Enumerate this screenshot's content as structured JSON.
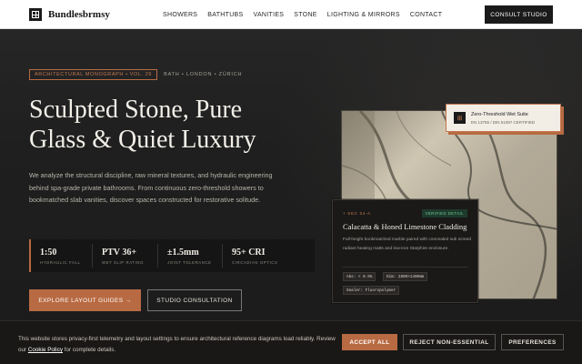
{
  "nav": {
    "brand": "Bundlesbrmsy",
    "links": [
      "SHOWERS",
      "BATHTUBS",
      "VANITIES",
      "STONE",
      "LIGHTING & MIRRORS",
      "CONTACT"
    ],
    "cta": "CONSULT STUDIO"
  },
  "hero": {
    "tag": "ARCHITECTURAL MONOGRAPH • VOL. 26",
    "cities": "BATH • LONDON • ZÜRICH",
    "title": "Sculpted Stone, Pure Glass & Quiet Luxury",
    "description": "We analyze the structural discipline, raw mineral textures, and hydraulic engineering behind spa-grade private bathrooms. From continuous zero-threshold showers to bookmatched slab vanities, discover spaces constructed for restorative solitude.",
    "stats": [
      {
        "value": "1:50",
        "label": "HYDRAULIC FALL"
      },
      {
        "value": "PTV 36+",
        "label": "WET SLIP RATING"
      },
      {
        "value": "±1.5mm",
        "label": "JOINT TOLERANCE"
      },
      {
        "value": "95+ CRI",
        "label": "CIRCADIAN OPTICS"
      }
    ],
    "primary_button": "EXPLORE LAYOUT GUIDES →",
    "secondary_button": "STUDIO CONSULTATION"
  },
  "visual_card": {
    "icon": "grid-icon",
    "title": "Zero-Threshold Wet Suite",
    "subtitle": "EN 13755 / DIN 51097 CERTIFIED"
  },
  "detail_card": {
    "section": "+ SEC 04-A",
    "badge": "VERIFIED DETAIL",
    "title": "Calacatta & Honed Limestone Cladding",
    "text": "Full-height bookmatched marble paired with concealed sub screed radiant heating matts and low-iron Starphire enclosure.",
    "chips": [
      "Abs: < 0.5%",
      "Dim: 2800×1400mm",
      "Sealer: Fluoropolymer"
    ]
  },
  "cookie": {
    "text": "This website stores privacy-first telemetry and layout settings to ensure architectural reference diagrams load reliably. Review our",
    "link": "Cookie Policy",
    "text_end": "for complete details.",
    "accept": "ACCEPT ALL",
    "reject": "REJECT NON-ESSENTIAL",
    "preferences": "PREFERENCES"
  },
  "colors": {
    "accent": "#b86a42",
    "background": "#1d1d1d",
    "nav_bg": "#ffffff"
  }
}
